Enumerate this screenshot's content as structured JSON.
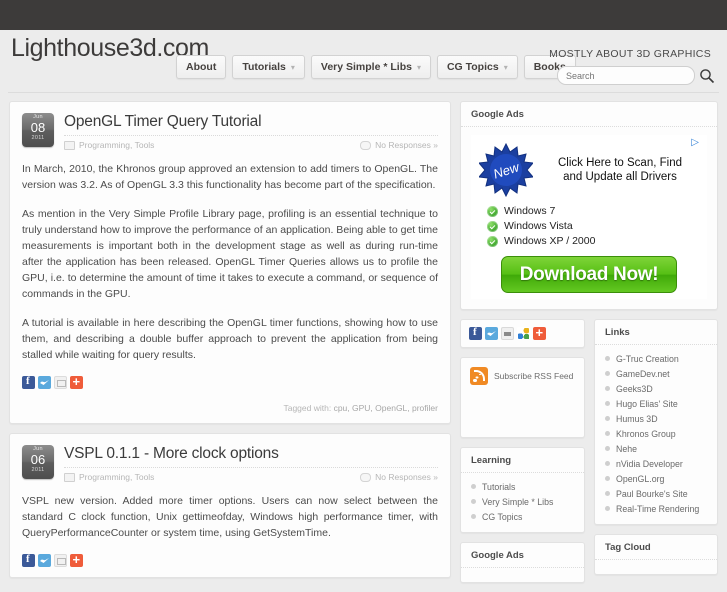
{
  "site": {
    "title": "Lighthouse3d.com",
    "tagline": "MOSTLY ABOUT 3D GRAPHICS"
  },
  "nav": {
    "items": [
      {
        "label": "About",
        "caret": false
      },
      {
        "label": "Tutorials",
        "caret": true
      },
      {
        "label": "Very Simple * Libs",
        "caret": true
      },
      {
        "label": "CG Topics",
        "caret": true
      },
      {
        "label": "Books",
        "caret": false
      }
    ]
  },
  "search": {
    "value": "",
    "placeholder": "Search",
    "icon": "search-icon"
  },
  "posts": [
    {
      "date": {
        "month": "Jun",
        "day": "08",
        "year": "2011"
      },
      "title": "OpenGL Timer Query Tutorial",
      "categories": "Programming, Tools",
      "responses": "No Responses »",
      "paragraphs": [
        "In March, 2010, the Khronos group approved an extension to add timers to OpenGL. The version was 3.2. As of OpenGL 3.3 this functionality has become part of the specification.",
        "As mention in the Very Simple Profile Library page, profiling is an essential technique to truly understand how to improve the performance of an application. Being able to get time measurements is important both in the development stage as well as during run-time after the application has been released. OpenGL Timer Queries allows us to profile the GPU, i.e. to determine the amount of time it takes to execute a command, or sequence of commands in the GPU.",
        "A tutorial is available in here describing the OpenGL timer functions, showing how to use them, and describing a double buffer approach to prevent the application from being stalled while waiting for query results."
      ],
      "tagged_label": "Tagged with:",
      "tags": "cpu, GPU, OpenGL, profiler",
      "share": [
        "facebook-icon",
        "twitter-icon",
        "email-icon",
        "addthis-icon"
      ]
    },
    {
      "date": {
        "month": "Jun",
        "day": "06",
        "year": "2011"
      },
      "title": "VSPL 0.1.1 - More clock options",
      "categories": "Programming, Tools",
      "responses": "No Responses »",
      "paragraphs": [
        "VSPL new version. Added more timer options. Users can now select between the standard C clock function, Unix gettimeofday, Windows high performance timer, with QueryPerformanceCounter or system time, using GetSystemTime."
      ],
      "share": [
        "facebook-icon",
        "twitter-icon",
        "email-icon",
        "addthis-icon"
      ]
    }
  ],
  "sidebar": {
    "google_ads_title": "Google Ads",
    "ad": {
      "badge": "New",
      "headline_line1": "Click Here to Scan, Find",
      "headline_line2": "and Update all Drivers",
      "items": [
        "Windows  7",
        "Windows  Vista",
        "Windows  XP / 2000"
      ],
      "cta": "Download Now!"
    },
    "share_icons": [
      "facebook-icon",
      "twitter-icon",
      "print-icon",
      "share-icon",
      "addthis-icon"
    ],
    "rss": {
      "label": "Subscribe RSS Feed",
      "icon": "rss-icon"
    },
    "learning": {
      "title": "Learning",
      "items": [
        "Tutorials",
        "Very Simple * Libs",
        "CG Topics"
      ]
    },
    "google_ads_title2": "Google Ads",
    "links": {
      "title": "Links",
      "items": [
        "G-Truc Creation",
        "GameDev.net",
        "Geeks3D",
        "Hugo Elias' Site",
        "Humus 3D",
        "Khronos Group",
        "Nehe",
        "nVidia Developer",
        "OpenGL.org",
        "Paul Bourke's Site",
        "Real-Time Rendering"
      ]
    },
    "tag_cloud": {
      "title": "Tag Cloud"
    }
  },
  "colors": {
    "topbar": "#3d3b3a",
    "page_bg": "#ececec",
    "card_bg": "#fdfdfd",
    "accent_green": "#55bf14",
    "facebook": "#3b5998",
    "twitter": "#5aa9dd",
    "addthis": "#ef5c3a",
    "rss_orange": "#f08a24"
  }
}
